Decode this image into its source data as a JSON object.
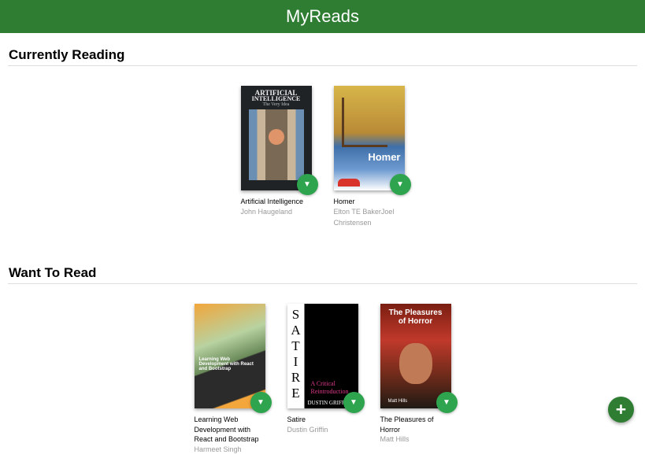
{
  "app": {
    "title": "MyReads"
  },
  "shelves": [
    {
      "title": "Currently Reading",
      "books": [
        {
          "title": "Artificial Intelligence",
          "authors": "John Haugeland",
          "cover": {
            "line1": "ARTIFICIAL",
            "line2": "INTELLIGENCE",
            "line3": "The Very Idea"
          }
        },
        {
          "title": "Homer",
          "authors": "Elton TE BakerJoel Christensen",
          "cover": {
            "line1": "Homer"
          }
        }
      ]
    },
    {
      "title": "Want To Read",
      "books": [
        {
          "title": "Learning Web Development with React and Bootstrap",
          "authors": "Harmeet Singh",
          "cover": {
            "line1": "Learning Web Development with React and Bootstrap"
          }
        },
        {
          "title": "Satire",
          "authors": "Dustin Griffin",
          "cover": {
            "line1": "SATIRE",
            "line2": "A Critical Reintroduction",
            "line3": "DUSTIN GRIFFIN"
          }
        },
        {
          "title": "The Pleasures of Horror",
          "authors": "Matt Hills",
          "cover": {
            "line1": "The Pleasures of Horror",
            "line2": "Matt Hills"
          }
        }
      ]
    }
  ],
  "icons": {
    "shelf_changer": "chevron-down-icon",
    "add": "plus-icon"
  },
  "colors": {
    "header": "#2e7d32",
    "changer": "#2ea44f",
    "author_text": "#999999"
  }
}
